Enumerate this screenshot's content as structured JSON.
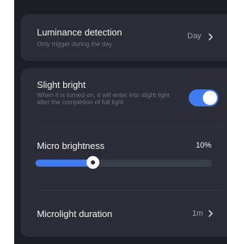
{
  "colors": {
    "background": "#1b1e25",
    "card": "#2a2d35",
    "accent": "#3f7cf4",
    "text": "#f2f3f5",
    "muted": "#6d717b"
  },
  "luminance": {
    "title": "Luminance detection",
    "subtitle": "Only trigger during the day",
    "value": "Day",
    "icon": "chevron-right-icon"
  },
  "slight_bright": {
    "title": "Slight bright",
    "description": "When it is turned on, it will enter into slight light after the completion of full light",
    "enabled": true
  },
  "micro_brightness": {
    "label": "Micro brightness",
    "value_text": "10%",
    "slider_value": 0.325
  },
  "microlight_duration": {
    "label": "Microlight duration",
    "value": "1m",
    "icon": "chevron-right-icon"
  }
}
